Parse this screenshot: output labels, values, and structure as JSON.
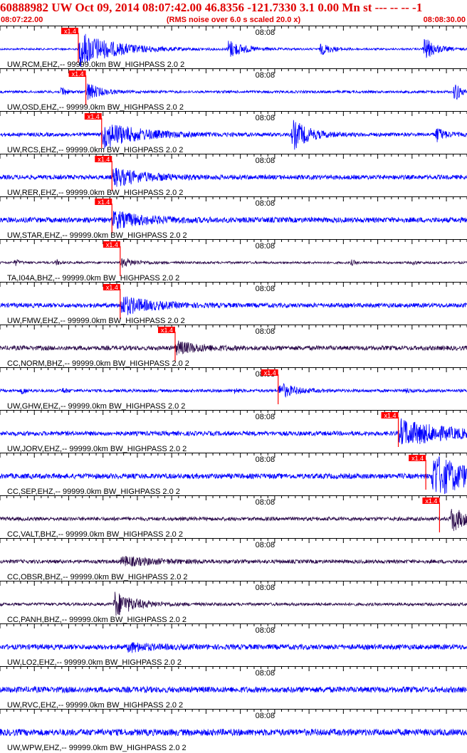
{
  "header": {
    "title": "60888982 UW Oct 09, 2014 08:07:42.00   46.8356 -121.7330  3.1 0.00 Mn st --- -- --  -1",
    "start_time": "08:07:22.00",
    "end_time": "08:08:30.00",
    "noise_note": "(RMS noise over 6.0 s scaled 20.0 x)"
  },
  "colors": {
    "header_red": "#e00000",
    "trace_blue": "#0000ff",
    "trace_dark": "#2a0a4a",
    "pick_red": "#ff0000",
    "tick_black": "#000000"
  },
  "chart_data": {
    "type": "seismogram",
    "x_range_seconds": [
      0,
      68
    ],
    "minute_marker": {
      "label": "08:08",
      "t": 38
    },
    "pick_label": "x1.4",
    "traces": [
      {
        "label": "UW,RCM,EHZ,-- 99999.0km BW_HIGHPASS  2.0  2",
        "color": "blue",
        "pick": 11.4,
        "bursts": [
          {
            "t": 11.4,
            "a": 1.0,
            "d": 9
          },
          {
            "t": 33,
            "a": 0.55,
            "d": 4
          },
          {
            "t": 46.5,
            "a": 0.35,
            "d": 3
          },
          {
            "t": 61.5,
            "a": 0.75,
            "d": 3
          }
        ],
        "noise": 0.05
      },
      {
        "label": "UW,OSD,EHZ,-- 99999.0km BW_HIGHPASS  2.0  2",
        "color": "blue",
        "pick": 12.5,
        "bursts": [
          {
            "t": 8.8,
            "a": 0.5,
            "d": 1
          },
          {
            "t": 12.5,
            "a": 0.6,
            "d": 3
          },
          {
            "t": 66,
            "a": 0.9,
            "d": 1.2
          }
        ],
        "noise": 0.07
      },
      {
        "label": "UW,RCS,EHZ,-- 99999.0km BW_HIGHPASS  2.0  2",
        "color": "blue",
        "pick": 14.8,
        "bursts": [
          {
            "t": 14.8,
            "a": 0.75,
            "d": 9
          },
          {
            "t": 42.4,
            "a": 0.9,
            "d": 4
          },
          {
            "t": 63.3,
            "a": 0.5,
            "d": 2
          }
        ],
        "noise": 0.1
      },
      {
        "label": "UW,RER,EHZ,-- 99999.0km BW_HIGHPASS  2.0  2",
        "color": "blue",
        "pick": 16.3,
        "bursts": [
          {
            "t": 16.3,
            "a": 0.5,
            "d": 8
          }
        ],
        "noise": 0.12
      },
      {
        "label": "UW,STAR,EHZ,-- 99999.0km BW_HIGHPASS  2.0  2",
        "color": "blue",
        "pick": 16.3,
        "bursts": [
          {
            "t": 16.3,
            "a": 0.45,
            "d": 8
          }
        ],
        "noise": 0.14
      },
      {
        "label": "TA,I04A,BHZ,-- 99999.0km BW_HIGHPASS  2.0  2",
        "color": "dark",
        "pick": 17.5,
        "bursts": [
          {
            "t": 2,
            "a": 0.25,
            "d": 1
          },
          {
            "t": 8,
            "a": 0.2,
            "d": 1
          },
          {
            "t": 17.5,
            "a": 0.25,
            "d": 4
          },
          {
            "t": 51,
            "a": 0.2,
            "d": 1
          },
          {
            "t": 60,
            "a": 0.15,
            "d": 1
          }
        ],
        "noise": 0.06
      },
      {
        "label": "UW,FMW,EHZ,-- 99999.0km BW_HIGHPASS  2.0  2",
        "color": "blue",
        "pick": 17.5,
        "bursts": [
          {
            "t": 17.5,
            "a": 0.55,
            "d": 7
          }
        ],
        "noise": 0.12
      },
      {
        "label": "CC,NORM,BHZ,-- 99999.0km BW_HIGHPASS  2.0  2",
        "color": "dark",
        "pick": 25.5,
        "bursts": [
          {
            "t": 25.5,
            "a": 0.35,
            "d": 6
          }
        ],
        "noise": 0.12
      },
      {
        "label": "UW,GHW,EHZ,-- 99999.0km BW_HIGHPASS  2.0  2",
        "color": "blue",
        "pick": 40.5,
        "bursts": [
          {
            "t": 3,
            "a": 0.25,
            "d": 1
          },
          {
            "t": 9,
            "a": 0.2,
            "d": 1
          },
          {
            "t": 34,
            "a": 0.2,
            "d": 1
          },
          {
            "t": 40.5,
            "a": 0.45,
            "d": 4
          },
          {
            "t": 59,
            "a": 0.15,
            "d": 1
          }
        ],
        "noise": 0.08
      },
      {
        "label": "UW,JORV,EHZ,-- 99999.0km BW_HIGHPASS  2.0  2",
        "color": "blue",
        "pick": 58,
        "bursts": [
          {
            "t": 58,
            "a": 0.75,
            "d": 12
          }
        ],
        "noise": 0.12
      },
      {
        "label": "CC,SEP,EHZ,-- 99999.0km BW_HIGHPASS  2.0  2",
        "color": "blue",
        "pick": 62,
        "bursts": [
          {
            "t": 62.8,
            "a": 1.2,
            "d": 10
          }
        ],
        "noise": 0.14
      },
      {
        "label": "CC,VALT,BHZ,-- 99999.0km BW_HIGHPASS  2.0  2",
        "color": "dark",
        "pick": 64,
        "bursts": [
          {
            "t": 65.5,
            "a": 0.75,
            "d": 4
          }
        ],
        "noise": 0.1
      },
      {
        "label": "CC,OBSR,BHZ,-- 99999.0km BW_HIGHPASS  2.0  2",
        "color": "dark",
        "pick": null,
        "bursts": [
          {
            "t": 17.5,
            "a": 0.25,
            "d": 9
          }
        ],
        "noise": 0.1
      },
      {
        "label": "CC,PANH,BHZ,-- 99999.0km BW_HIGHPASS  2.0  2",
        "color": "dark",
        "pick": null,
        "bursts": [
          {
            "t": 16.5,
            "a": 0.75,
            "d": 5
          }
        ],
        "noise": 0.08
      },
      {
        "label": "UW,LO2,EHZ,-- 99999.0km BW_HIGHPASS  2.0  2",
        "color": "blue",
        "pick": null,
        "bursts": [
          {
            "t": 18.5,
            "a": 0.25,
            "d": 5
          }
        ],
        "noise": 0.14
      },
      {
        "label": "UW,RVC,EHZ,-- 99999.0km BW_HIGHPASS  2.0  2",
        "color": "blue",
        "pick": null,
        "bursts": [],
        "noise": 0.16
      },
      {
        "label": "UW,WPW,EHZ,-- 99999.0km BW_HIGHPASS  2.0  2",
        "color": "blue",
        "pick": null,
        "bursts": [],
        "noise": 0.18
      }
    ]
  }
}
